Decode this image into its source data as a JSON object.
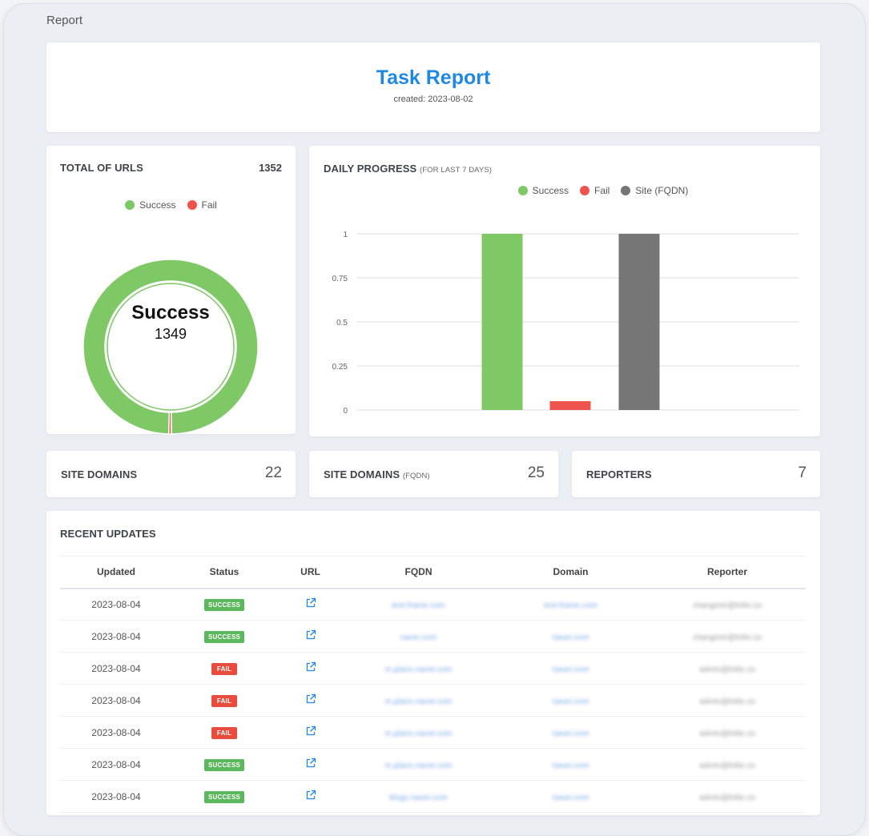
{
  "page_label": "Report",
  "header": {
    "title": "Task Report",
    "created": "created: 2023-08-02"
  },
  "colors": {
    "success": "#7ec865",
    "fail": "#ef5350",
    "site": "#767676",
    "title_blue": "#1e88e5"
  },
  "total_urls": {
    "title": "TOTAL OF URLS",
    "total": "1352",
    "legend": [
      "Success",
      "Fail"
    ],
    "center_label": "Success",
    "center_value": "1349"
  },
  "daily_progress": {
    "title": "DAILY PROGRESS",
    "subtitle": "(FOR LAST 7 DAYS)",
    "legend": [
      "Success",
      "Fail",
      "Site (FQDN)"
    ]
  },
  "chart_data": [
    {
      "type": "pie",
      "variant": "donut",
      "labels": [
        "Success",
        "Fail"
      ],
      "values": [
        1349,
        3
      ],
      "colors": [
        "#7ec865",
        "#ef5350"
      ],
      "legend_position": "top"
    },
    {
      "type": "bar",
      "categories": [
        "Success",
        "Fail",
        "Site (FQDN)"
      ],
      "values": [
        1,
        0.05,
        1
      ],
      "colors": [
        "#7ec865",
        "#ef5350",
        "#767676"
      ],
      "yticks": [
        "0",
        "0.25",
        "0.5",
        "0.75",
        "1"
      ],
      "ylim": [
        0,
        1
      ],
      "grid": true,
      "legend_position": "top"
    }
  ],
  "stats": {
    "site_domains": {
      "label": "SITE DOMAINS",
      "value": "22"
    },
    "site_domains_fqdn": {
      "label": "SITE DOMAINS",
      "sublabel": "(FQDN)",
      "value": "25"
    },
    "reporters": {
      "label": "REPORTERS",
      "value": "7"
    }
  },
  "recent": {
    "title": "RECENT UPDATES",
    "columns": [
      "Updated",
      "Status",
      "URL",
      "FQDN",
      "Domain",
      "Reporter"
    ],
    "rows": [
      {
        "updated": "2023-08-04",
        "status": "SUCCESS",
        "fqdn": "test-frame.com",
        "domain": "test-frame.com",
        "reporter": "changmin@lotte.co"
      },
      {
        "updated": "2023-08-04",
        "status": "SUCCESS",
        "fqdn": "naver.com",
        "domain": "naver.com",
        "reporter": "changmin@lotte.co"
      },
      {
        "updated": "2023-08-04",
        "status": "FAIL",
        "fqdn": "m.place.naver.com",
        "domain": "naver.com",
        "reporter": "admin@lotte.co"
      },
      {
        "updated": "2023-08-04",
        "status": "FAIL",
        "fqdn": "m.place.naver.com",
        "domain": "naver.com",
        "reporter": "admin@lotte.co"
      },
      {
        "updated": "2023-08-04",
        "status": "FAIL",
        "fqdn": "m.place.naver.com",
        "domain": "naver.com",
        "reporter": "admin@lotte.co"
      },
      {
        "updated": "2023-08-04",
        "status": "SUCCESS",
        "fqdn": "m.place.naver.com",
        "domain": "naver.com",
        "reporter": "admin@lotte.co"
      },
      {
        "updated": "2023-08-04",
        "status": "SUCCESS",
        "fqdn": "blogs.naver.com",
        "domain": "naver.com",
        "reporter": "admin@lotte.co"
      }
    ]
  }
}
